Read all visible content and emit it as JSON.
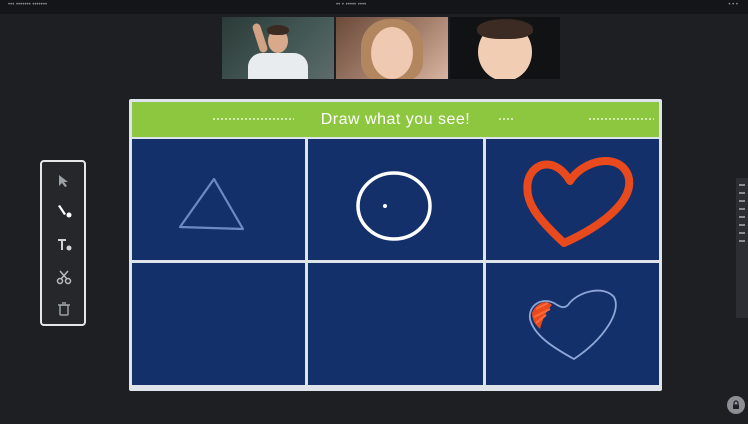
{
  "window": {
    "left_text": "••• ••••••• •••••••",
    "center_text": "•• • ••••• ••••",
    "right_text": "• • •"
  },
  "participants": [
    {
      "label": "teacher-video",
      "tile": "t1"
    },
    {
      "label": "student-girl-video",
      "tile": "t2"
    },
    {
      "label": "student-boy-video",
      "tile": "t3"
    }
  ],
  "whiteboard": {
    "title": "Draw what you see!",
    "cells": [
      {
        "drawing": "triangle"
      },
      {
        "drawing": "circle"
      },
      {
        "drawing": "heart"
      },
      {
        "drawing": "empty"
      },
      {
        "drawing": "empty"
      },
      {
        "drawing": "heart-sketch"
      }
    ]
  },
  "toolbar": {
    "tools": [
      {
        "icon": "select-icon"
      },
      {
        "icon": "pen-icon"
      },
      {
        "icon": "text-icon"
      },
      {
        "icon": "scissors-icon"
      },
      {
        "icon": "trash-icon"
      }
    ]
  },
  "colors": {
    "background": "#1e1f22",
    "header_green": "#8dc63f",
    "board_blue": "#14306a",
    "ink_orange": "#e8491d",
    "ink_white": "#ffffff",
    "ink_light_blue": "#8fa6d8"
  }
}
